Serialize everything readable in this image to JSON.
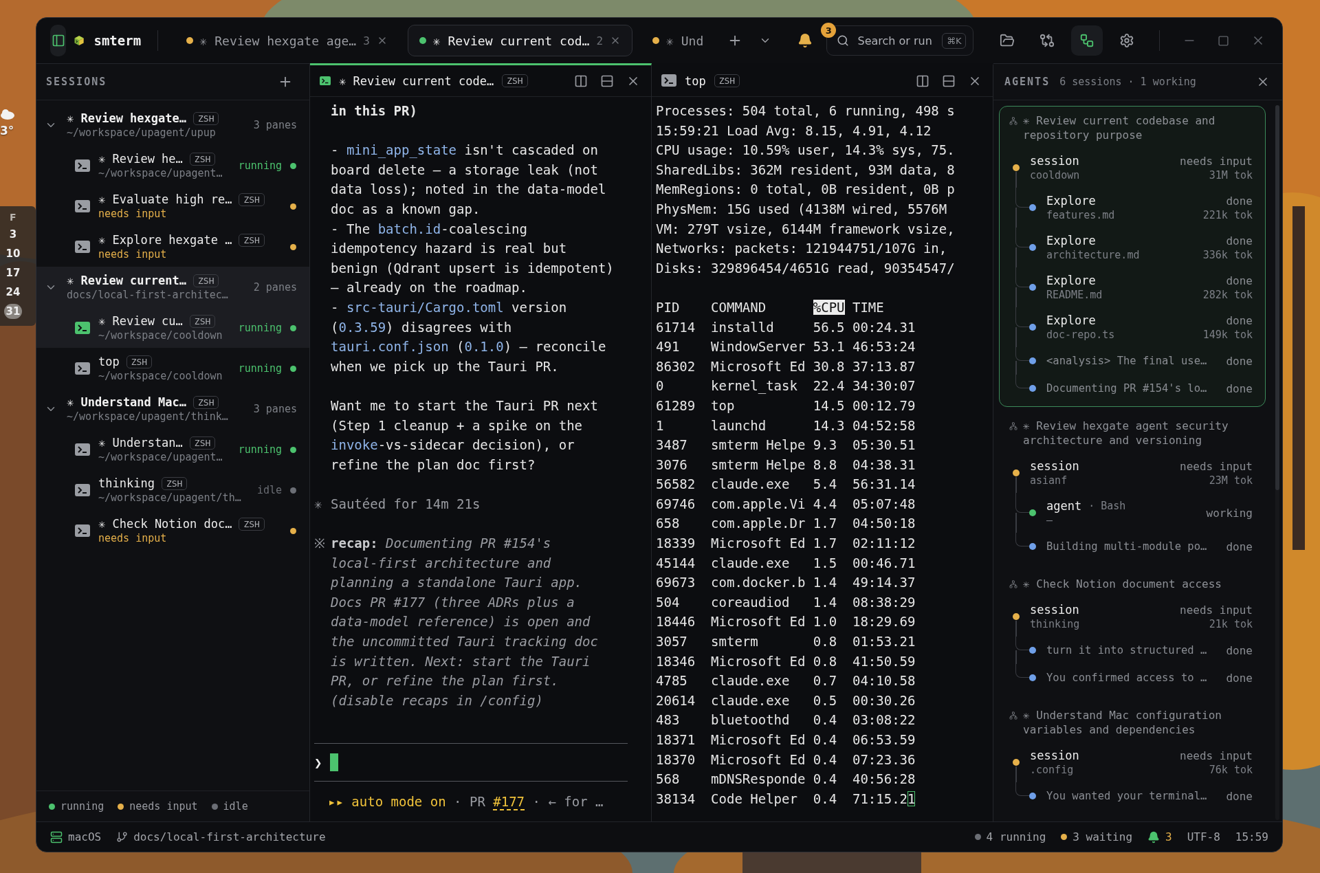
{
  "desktop": {
    "weather": "3°",
    "calendar": {
      "weekday": "F",
      "dates": [
        {
          "text": "3",
          "selected": false
        },
        {
          "text": "10",
          "selected": false
        },
        {
          "text": "17",
          "selected": false
        },
        {
          "text": "24",
          "selected": false
        },
        {
          "text": "31",
          "selected": true
        }
      ]
    }
  },
  "titlebar": {
    "sidebar_toggle": {
      "on": true
    },
    "app_name": "smterm",
    "tabs": [
      {
        "label": "✳ Review hexgate age…",
        "count": "3",
        "color": "#e5b04a",
        "selected": false
      },
      {
        "label": "✳ Review current cod…",
        "count": "2",
        "color": "#4cc26e",
        "selected": true
      },
      {
        "label": "✳ Und",
        "color": "#e5b04a",
        "selected": false
      }
    ],
    "notifications": {
      "count": "3"
    },
    "search": {
      "placeholder": "Search or run",
      "shortcut": "⌘K"
    },
    "tools": [
      {
        "kind": "folder",
        "selected": false
      },
      {
        "kind": "git",
        "selected": false
      },
      {
        "kind": "agents",
        "selected": true
      },
      {
        "kind": "settings",
        "selected": false
      }
    ]
  },
  "sidebar": {
    "title": "SESSIONS",
    "groups": [
      {
        "title": "✳ Review hexgate…",
        "shell": "ZSH",
        "path": "~/workspace/upagent/upup",
        "panes": "3 panes",
        "expanded": true,
        "selected": false,
        "items": [
          {
            "title": "✳ Review he…",
            "shell": "ZSH",
            "detail": "~/workspace/upagent…",
            "status": "running",
            "color": "#4cc26e",
            "selected": false
          },
          {
            "title": "✳ Evaluate high re…",
            "shell": "ZSH",
            "detail": "needs input",
            "color": "#e5b04a",
            "selected": false
          },
          {
            "title": "✳ Explore hexgate …",
            "shell": "ZSH",
            "detail": "needs input",
            "color": "#e5b04a",
            "selected": false
          }
        ]
      },
      {
        "title": "✳ Review current…",
        "shell": "ZSH",
        "path": "docs/local-first-architec…",
        "panes": "2 panes",
        "expanded": true,
        "selected": true,
        "items": [
          {
            "title": "✳ Review cu…",
            "shell": "ZSH",
            "detail": "~/workspace/cooldown",
            "status": "running",
            "color": "#4cc26e",
            "selected": true
          },
          {
            "title": "top",
            "shell": "ZSH",
            "detail": "~/workspace/cooldown",
            "status": "running",
            "color": "#4cc26e",
            "selected": false
          }
        ]
      },
      {
        "title": "✳ Understand Mac…",
        "shell": "ZSH",
        "path": "~/workspace/upagent/think…",
        "panes": "3 panes",
        "expanded": true,
        "selected": false,
        "items": [
          {
            "title": "✳ Understan…",
            "shell": "ZSH",
            "detail": "~/workspace/upagent…",
            "status": "running",
            "color": "#4cc26e",
            "selected": false
          },
          {
            "title": "thinking",
            "shell": "ZSH",
            "detail": "~/workspace/upagent/th…",
            "status": "idle",
            "color": "#6b6e75",
            "selected": false
          },
          {
            "title": "✳ Check Notion doc…",
            "shell": "ZSH",
            "detail": "needs input",
            "color": "#e5b04a",
            "selected": false
          }
        ]
      }
    ],
    "legend": [
      {
        "label": "running",
        "color": "#4cc26e"
      },
      {
        "label": "needs input",
        "color": "#e5b04a"
      },
      {
        "label": "idle",
        "color": "#6b6e75"
      }
    ]
  },
  "panes": [
    {
      "kind": "transcript",
      "title": "✳ Review current code…",
      "shell": "ZSH",
      "selected": true,
      "lines": [
        {
          "kind": "bold",
          "text": "in this PR)"
        },
        {
          "kind": "blank"
        },
        {
          "kind": "plain",
          "segments": [
            {
              "text": "- "
            },
            {
              "text": "mini_app_state",
              "code": true
            },
            {
              "text": " isn't cascaded on"
            }
          ]
        },
        {
          "kind": "plain",
          "text": "board delete — a storage leak (not"
        },
        {
          "kind": "plain",
          "text": "data loss); noted in the data-model"
        },
        {
          "kind": "plain",
          "text": "doc as a known gap."
        },
        {
          "kind": "plain",
          "segments": [
            {
              "text": "- The "
            },
            {
              "text": "batch.id",
              "code": true
            },
            {
              "text": "-coalescing"
            }
          ]
        },
        {
          "kind": "plain",
          "text": "idempotency hazard is real but"
        },
        {
          "kind": "plain",
          "text": "benign (Qdrant upsert is idempotent)"
        },
        {
          "kind": "plain",
          "text": "— already on the roadmap."
        },
        {
          "kind": "plain",
          "segments": [
            {
              "text": "- "
            },
            {
              "text": "src-tauri/Cargo.toml",
              "code": true
            },
            {
              "text": " version"
            }
          ]
        },
        {
          "kind": "plain",
          "segments": [
            {
              "text": "("
            },
            {
              "text": "0.3.59",
              "code": true
            },
            {
              "text": ") disagrees with"
            }
          ]
        },
        {
          "kind": "plain",
          "segments": [
            {
              "text": "tauri.conf.json",
              "code": true
            },
            {
              "text": " ("
            },
            {
              "text": "0.1.0",
              "code": true
            },
            {
              "text": ") — reconcile"
            }
          ]
        },
        {
          "kind": "plain",
          "text": "when we pick up the Tauri PR."
        },
        {
          "kind": "blank"
        },
        {
          "kind": "plain",
          "text": "Want me to start the Tauri PR next"
        },
        {
          "kind": "plain",
          "text": "(Step 1 cleanup + a spike on the"
        },
        {
          "kind": "plain",
          "segments": [
            {
              "text": "invoke",
              "code": true
            },
            {
              "text": "-vs-sidecar decision), or"
            }
          ]
        },
        {
          "kind": "plain",
          "text": "refine the plan doc first?"
        },
        {
          "kind": "blank"
        },
        {
          "kind": "muted",
          "gutter": "✳",
          "text": "Sautéed for 14m 21s"
        },
        {
          "kind": "blank"
        },
        {
          "kind": "rich",
          "gutter": "※",
          "text": "**recap:** *Documenting PR #154's*"
        },
        {
          "kind": "italic",
          "text": "local-first architecture and"
        },
        {
          "kind": "italic",
          "text": "planning a standalone Tauri app."
        },
        {
          "kind": "italic",
          "text": "Docs PR #177 (three ADRs plus a"
        },
        {
          "kind": "italic",
          "text": "data-model reference) is open and"
        },
        {
          "kind": "italic",
          "text": "the uncommitted Tauri tracking doc"
        },
        {
          "kind": "italic",
          "text": "is written. Next: start the Tauri"
        },
        {
          "kind": "italic",
          "text": "PR, or refine the plan first."
        },
        {
          "kind": "italic",
          "text": "(disable recaps in /config)"
        }
      ],
      "prompt": "❯",
      "footer": [
        {
          "text": "▸▸ auto mode on",
          "kind": "accent"
        },
        {
          "text": "·",
          "kind": "muted"
        },
        {
          "text": "PR",
          "kind": "muted"
        },
        {
          "text": "#177",
          "kind": "link"
        },
        {
          "text": "·",
          "kind": "muted"
        },
        {
          "text": "← for …",
          "kind": "muted"
        }
      ]
    },
    {
      "kind": "top",
      "title": "top",
      "shell": "ZSH",
      "selected": false,
      "summary": [
        "Processes: 504 total, 6 running, 498 s",
        "15:59:21 Load Avg: 8.15, 4.91, 4.12",
        "CPU usage: 10.59% user, 14.3% sys, 75.",
        "SharedLibs: 362M resident, 93M data, 8",
        "MemRegions: 0 total, 0B resident, 0B p",
        "PhysMem: 15G used (4138M wired, 5576M",
        "VM: 279T vsize, 6144M framework vsize,",
        "Networks: packets: 121944751/107G in,",
        "Disks: 329896454/4651G read, 90354547/"
      ],
      "columns": [
        {
          "label": "PID",
          "highlighted": false
        },
        {
          "label": "COMMAND",
          "highlighted": false
        },
        {
          "label": "%CPU",
          "highlighted": true
        },
        {
          "label": "TIME",
          "highlighted": false
        }
      ],
      "rows": [
        {
          "pid": "61714",
          "command": "installd",
          "cpu": "56.5",
          "time": "00:24.31",
          "cursor": false
        },
        {
          "pid": "491",
          "command": "WindowServer",
          "cpu": "53.1",
          "time": "46:53:24",
          "cursor": false
        },
        {
          "pid": "86302",
          "command": "Microsoft Ed",
          "cpu": "30.8",
          "time": "37:13.87",
          "cursor": false
        },
        {
          "pid": "0",
          "command": "kernel_task",
          "cpu": "22.4",
          "time": "34:30:07",
          "cursor": false
        },
        {
          "pid": "61289",
          "command": "top",
          "cpu": "14.5",
          "time": "00:12.79",
          "cursor": false
        },
        {
          "pid": "1",
          "command": "launchd",
          "cpu": "14.3",
          "time": "04:52:58",
          "cursor": false
        },
        {
          "pid": "3487",
          "command": "smterm Helpe",
          "cpu": "9.3",
          "time": "05:30.51",
          "cursor": false
        },
        {
          "pid": "3076",
          "command": "smterm Helpe",
          "cpu": "8.8",
          "time": "04:38.31",
          "cursor": false
        },
        {
          "pid": "56582",
          "command": "claude.exe",
          "cpu": "5.4",
          "time": "56:31.14",
          "cursor": false
        },
        {
          "pid": "69746",
          "command": "com.apple.Vi",
          "cpu": "4.4",
          "time": "05:07:48",
          "cursor": false
        },
        {
          "pid": "658",
          "command": "com.apple.Dr",
          "cpu": "1.7",
          "time": "04:50:18",
          "cursor": false
        },
        {
          "pid": "18339",
          "command": "Microsoft Ed",
          "cpu": "1.7",
          "time": "02:11:12",
          "cursor": false
        },
        {
          "pid": "45144",
          "command": "claude.exe",
          "cpu": "1.5",
          "time": "00:46.71",
          "cursor": false
        },
        {
          "pid": "69673",
          "command": "com.docker.b",
          "cpu": "1.4",
          "time": "49:14.37",
          "cursor": false
        },
        {
          "pid": "504",
          "command": "coreaudiod",
          "cpu": "1.4",
          "time": "08:38:29",
          "cursor": false
        },
        {
          "pid": "18446",
          "command": "Microsoft Ed",
          "cpu": "1.0",
          "time": "18:29.69",
          "cursor": false
        },
        {
          "pid": "3057",
          "command": "smterm",
          "cpu": "0.8",
          "time": "01:53.21",
          "cursor": false
        },
        {
          "pid": "18346",
          "command": "Microsoft Ed",
          "cpu": "0.8",
          "time": "41:50.59",
          "cursor": false
        },
        {
          "pid": "4785",
          "command": "claude.exe",
          "cpu": "0.7",
          "time": "04:10.58",
          "cursor": false
        },
        {
          "pid": "20614",
          "command": "claude.exe",
          "cpu": "0.5",
          "time": "00:30.26",
          "cursor": false
        },
        {
          "pid": "483",
          "command": "bluetoothd",
          "cpu": "0.4",
          "time": "03:08:22",
          "cursor": false
        },
        {
          "pid": "18371",
          "command": "Microsoft Ed",
          "cpu": "0.4",
          "time": "06:53.59",
          "cursor": false
        },
        {
          "pid": "18370",
          "command": "Microsoft Ed",
          "cpu": "0.4",
          "time": "07:23.36",
          "cursor": false
        },
        {
          "pid": "568",
          "command": "mDNSResponde",
          "cpu": "0.4",
          "time": "40:56:28",
          "cursor": false
        },
        {
          "pid": "38134",
          "command": "Code Helper",
          "cpu": "0.4",
          "time": "71:15.21",
          "cursor": true
        }
      ]
    }
  ],
  "agents": {
    "title": "AGENTS",
    "summary": "6 sessions · 1 working",
    "groups": [
      {
        "title": "✳ Review current codebase and repository purpose",
        "selected": true,
        "session": {
          "name": "session",
          "detail": "cooldown",
          "status": "needs input",
          "tokens": "31M tok",
          "color": "#e5b04a"
        },
        "children": [
          {
            "kind": "agent",
            "name": "Explore",
            "detail": "features.md",
            "status": "done",
            "tokens": "221k tok",
            "color": "#6f9fe8"
          },
          {
            "kind": "agent",
            "name": "Explore",
            "detail": "architecture.md",
            "status": "done",
            "tokens": "336k tok",
            "color": "#6f9fe8"
          },
          {
            "kind": "agent",
            "name": "Explore",
            "detail": "README.md",
            "status": "done",
            "tokens": "282k tok",
            "color": "#6f9fe8"
          },
          {
            "kind": "agent",
            "name": "Explore",
            "detail": "doc-repo.ts",
            "status": "done",
            "tokens": "149k tok",
            "color": "#6f9fe8"
          },
          {
            "kind": "message",
            "text": "<analysis> The final use…",
            "status": "done",
            "color": "#6f9fe8"
          },
          {
            "kind": "message",
            "text": "Documenting PR #154's lo…",
            "status": "done",
            "color": "#6f9fe8"
          }
        ]
      },
      {
        "title": "✳ Review hexgate agent security architecture and versioning",
        "selected": false,
        "session": {
          "name": "session",
          "detail": "asianf",
          "status": "needs input",
          "tokens": "23M tok",
          "color": "#e5b04a"
        },
        "children": [
          {
            "kind": "agent",
            "name": "agent",
            "tool": "· Bash",
            "detail": "–",
            "status": "working",
            "color": "#4cc26e"
          },
          {
            "kind": "message",
            "text": "Building multi-module po…",
            "status": "done",
            "color": "#6f9fe8"
          }
        ]
      },
      {
        "title": "✳ Check Notion document access",
        "selected": false,
        "session": {
          "name": "session",
          "detail": "thinking",
          "status": "needs input",
          "tokens": "21k tok",
          "color": "#e5b04a"
        },
        "children": [
          {
            "kind": "message",
            "text": "turn it into structured …",
            "status": "done",
            "color": "#6f9fe8"
          },
          {
            "kind": "message",
            "text": "You confirmed access to …",
            "status": "done",
            "color": "#6f9fe8"
          }
        ]
      },
      {
        "title": "✳ Understand Mac configuration variables and dependencies",
        "selected": false,
        "session": {
          "name": "session",
          "detail": ".config",
          "status": "needs input",
          "tokens": "76k tok",
          "color": "#e5b04a"
        },
        "children": [
          {
            "kind": "message",
            "text": "You wanted your terminal…",
            "status": "done",
            "color": "#6f9fe8"
          }
        ]
      }
    ]
  },
  "status_bar": {
    "host": "macOS",
    "branch": "docs/local-first-architecture",
    "counts": [
      {
        "label": "4 running",
        "color": "#6b6e75"
      },
      {
        "label": "3 waiting",
        "color": "#e5b04a"
      }
    ],
    "notifications": "3",
    "encoding": "UTF-8",
    "time": "15:59"
  }
}
